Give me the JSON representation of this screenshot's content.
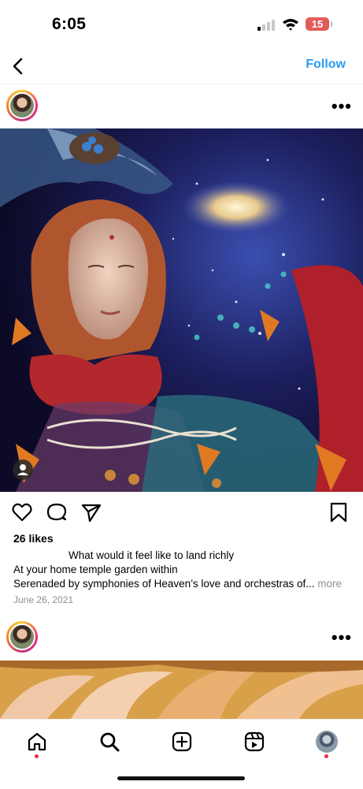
{
  "status_bar": {
    "time": "6:05",
    "battery": "15"
  },
  "nav": {
    "follow_label": "Follow"
  },
  "post": {
    "likes": "26 likes",
    "caption_lines": [
      "What would it feel like to land richly",
      "At your home temple garden within",
      "Serenaded by symphonies of Heaven’s love and orchestras of..."
    ],
    "more_label": "more",
    "date": "June 26, 2021"
  },
  "icons": {
    "back": "chevron-left-icon",
    "options": "more-horizontal-icon",
    "like": "heart-icon",
    "comment": "comment-icon",
    "share": "send-icon",
    "save": "bookmark-icon",
    "tabs": [
      "home-icon",
      "search-icon",
      "create-icon",
      "reels-icon",
      "profile-avatar"
    ]
  },
  "colors": {
    "accent": "#2a9df4",
    "notification": "#ed2b4a",
    "battery": "#e25c59"
  }
}
